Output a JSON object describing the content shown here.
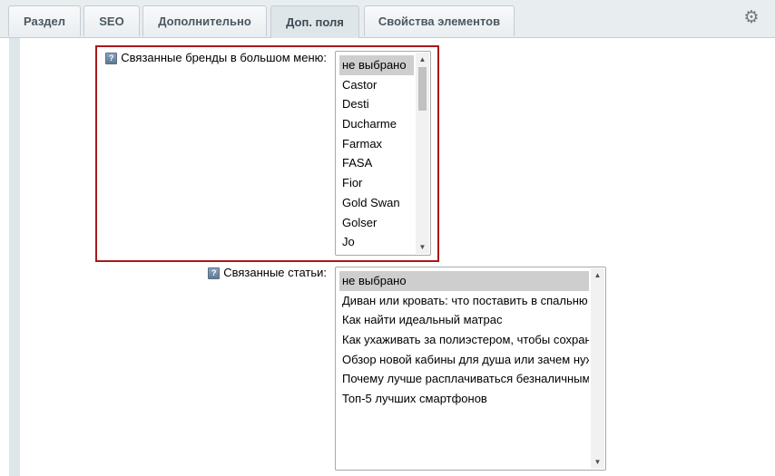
{
  "tabs": [
    {
      "label": "Раздел"
    },
    {
      "label": "SEO"
    },
    {
      "label": "Дополнительно"
    },
    {
      "label": "Доп. поля"
    },
    {
      "label": "Свойства элементов"
    }
  ],
  "icons": {
    "settings": "gear-icon",
    "help": "help-icon"
  },
  "fields": {
    "brands": {
      "label": "Связанные бренды в большом меню:",
      "options": [
        "не выбрано",
        "Castor",
        "Desti",
        "Ducharme",
        "Farmax",
        "FASA",
        "Fior",
        "Gold Swan",
        "Golser",
        "Jo"
      ],
      "selected_index": 0
    },
    "articles": {
      "label": "Связанные статьи:",
      "options": [
        "не выбрано",
        "Диван или кровать: что поставить в спальню",
        "Как найти идеальный матрас",
        "Как ухаживать за полиэстером, чтобы сохранить",
        "Обзор новой кабины для душа или зачем нужна",
        "Почему лучше расплачиваться безналичным",
        "Топ-5 лучших смартфонов"
      ],
      "selected_index": 0
    }
  },
  "colors": {
    "highlight_border": "#a6191b",
    "selected_option": "#cecece",
    "tab_active_bg": "#dfe6ea"
  }
}
